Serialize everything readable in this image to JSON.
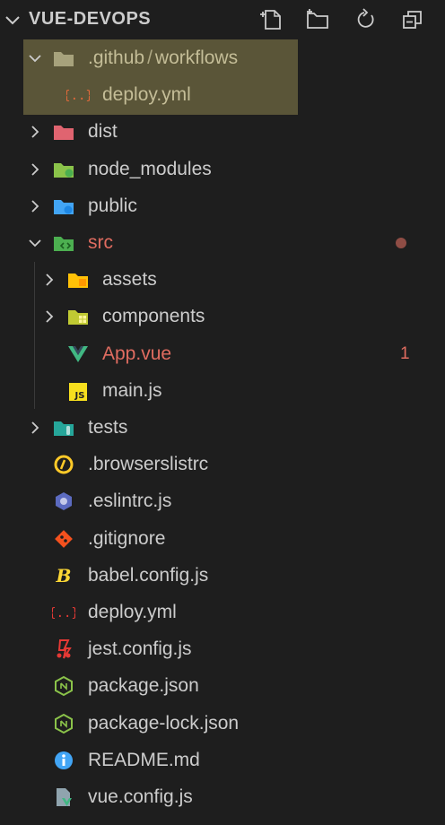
{
  "explorer": {
    "title": "VUE-DEVOPS",
    "actions": [
      "new-file-icon",
      "new-folder-icon",
      "refresh-icon",
      "collapse-all-icon"
    ]
  },
  "tree": [
    {
      "label": ".github",
      "label_b": "workflows",
      "separator": "/",
      "kind": "folder",
      "expanded": true,
      "depth": 0,
      "color": "#c4bd97"
    },
    {
      "label": "deploy.yml",
      "kind": "yaml",
      "depth": 1,
      "color": "#c4bd97"
    },
    {
      "label": "dist",
      "kind": "folder-dist",
      "expanded": false,
      "depth": 0,
      "color": "#cccccc"
    },
    {
      "label": "node_modules",
      "kind": "folder-node",
      "expanded": false,
      "depth": 0,
      "color": "#cccccc"
    },
    {
      "label": "public",
      "kind": "folder-public",
      "expanded": false,
      "depth": 0,
      "color": "#cccccc"
    },
    {
      "label": "src",
      "kind": "folder-src",
      "expanded": true,
      "depth": 0,
      "color": "#e06c60",
      "status": "dot",
      "status_color": "#8f4d45"
    },
    {
      "label": "assets",
      "kind": "folder-assets",
      "expanded": false,
      "depth": 1,
      "color": "#cccccc"
    },
    {
      "label": "components",
      "kind": "folder-components",
      "expanded": false,
      "depth": 1,
      "color": "#cccccc"
    },
    {
      "label": "App.vue",
      "kind": "vue",
      "depth": 1,
      "color": "#e06c60",
      "badge": "1",
      "badge_color": "#e06c60"
    },
    {
      "label": "main.js",
      "kind": "js",
      "depth": 1,
      "color": "#cccccc"
    },
    {
      "label": "tests",
      "kind": "folder-tests",
      "expanded": false,
      "depth": 0,
      "color": "#cccccc"
    },
    {
      "label": ".browserslistrc",
      "kind": "browserslist",
      "depth": 0,
      "color": "#cccccc"
    },
    {
      "label": ".eslintrc.js",
      "kind": "eslint",
      "depth": 0,
      "color": "#cccccc"
    },
    {
      "label": ".gitignore",
      "kind": "git",
      "depth": 0,
      "color": "#cccccc"
    },
    {
      "label": "babel.config.js",
      "kind": "babel",
      "depth": 0,
      "color": "#cccccc"
    },
    {
      "label": "deploy.yml",
      "kind": "yaml-red",
      "depth": 0,
      "color": "#cccccc"
    },
    {
      "label": "jest.config.js",
      "kind": "jest",
      "depth": 0,
      "color": "#cccccc"
    },
    {
      "label": "package.json",
      "kind": "npm",
      "depth": 0,
      "color": "#cccccc"
    },
    {
      "label": "package-lock.json",
      "kind": "npm",
      "depth": 0,
      "color": "#cccccc"
    },
    {
      "label": "README.md",
      "kind": "info",
      "depth": 0,
      "color": "#cccccc"
    },
    {
      "label": "vue.config.js",
      "kind": "vue-config",
      "depth": 0,
      "color": "#cccccc"
    }
  ]
}
